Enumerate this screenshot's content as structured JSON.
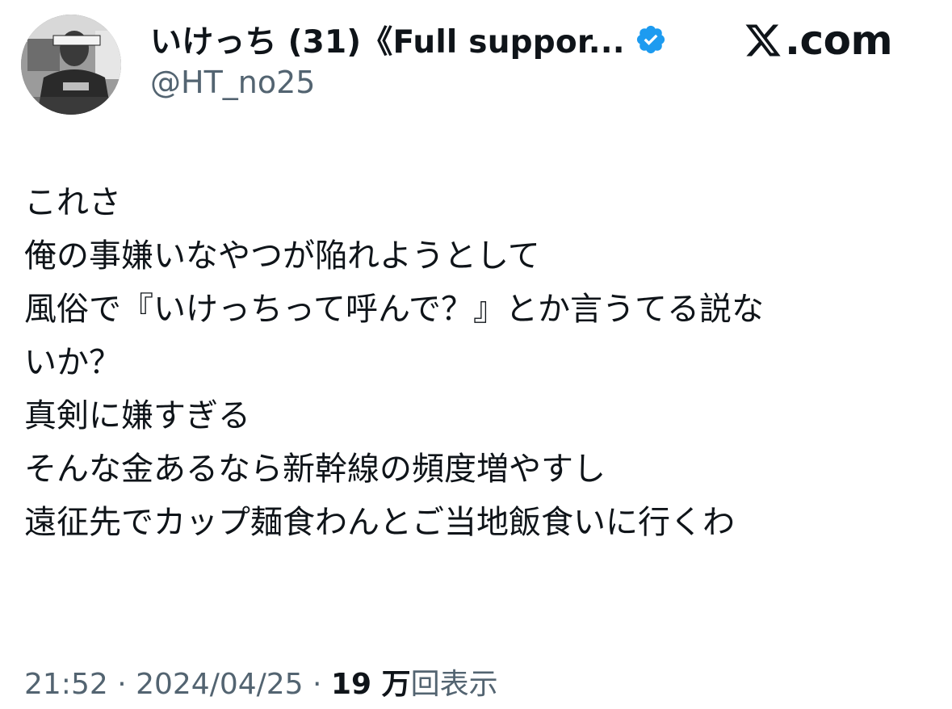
{
  "author": {
    "display_name": "いけっち (31)《Full suppor...",
    "handle": "@HT_no25",
    "verified_icon": "verified-badge-icon",
    "avatar_caption": "存在価値なし"
  },
  "brand": {
    "label": ".com",
    "logo_icon": "x-logo-icon"
  },
  "tweet": {
    "lines": [
      "これさ",
      "俺の事嫌いなやつが陥れようとして",
      "風俗で『いけっちって呼んで？』とか言うてる説な",
      "いか？",
      "真剣に嫌すぎる",
      "そんな金あるなら新幹線の頻度増やすし",
      "遠征先でカップ麺食わんとご当地飯食いに行くわ"
    ]
  },
  "meta": {
    "time": "21:52",
    "separator": "·",
    "date": "2024/04/25",
    "views_count": "19 万",
    "views_label": "回表示"
  },
  "colors": {
    "text": "#0f1419",
    "secondary": "#536471",
    "verified": "#1d9bf0"
  }
}
